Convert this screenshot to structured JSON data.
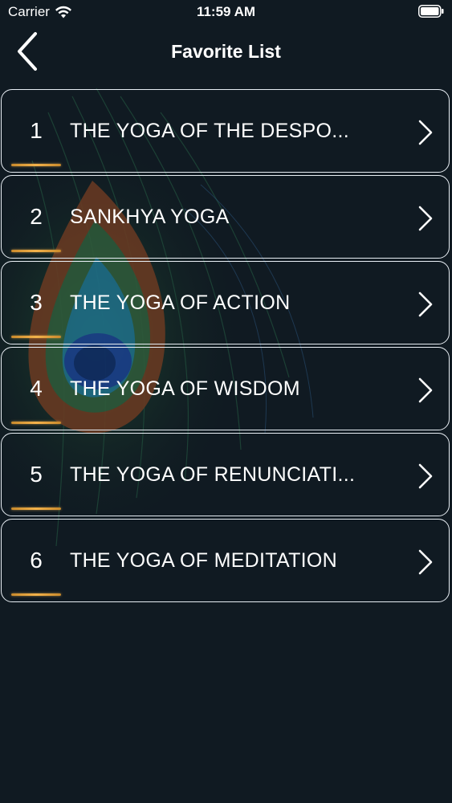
{
  "status_bar": {
    "carrier": "Carrier",
    "time": "11:59 AM",
    "wifi_icon": "wifi-icon",
    "battery_icon": "battery-icon"
  },
  "nav": {
    "title": "Favorite List",
    "back_icon": "chevron-left-icon"
  },
  "favorites": [
    {
      "number": "1",
      "title": "THE YOGA OF THE DESPO..."
    },
    {
      "number": "2",
      "title": "SANKHYA YOGA"
    },
    {
      "number": "3",
      "title": "THE YOGA OF ACTION"
    },
    {
      "number": "4",
      "title": "THE YOGA OF WISDOM"
    },
    {
      "number": "5",
      "title": "THE YOGA OF RENUNCIATI..."
    },
    {
      "number": "6",
      "title": "THE YOGA OF MEDITATION"
    }
  ],
  "colors": {
    "background": "#101a22",
    "text": "#ffffff",
    "row_border": "#e8eef4",
    "accent_underline": "#f3b24b"
  }
}
